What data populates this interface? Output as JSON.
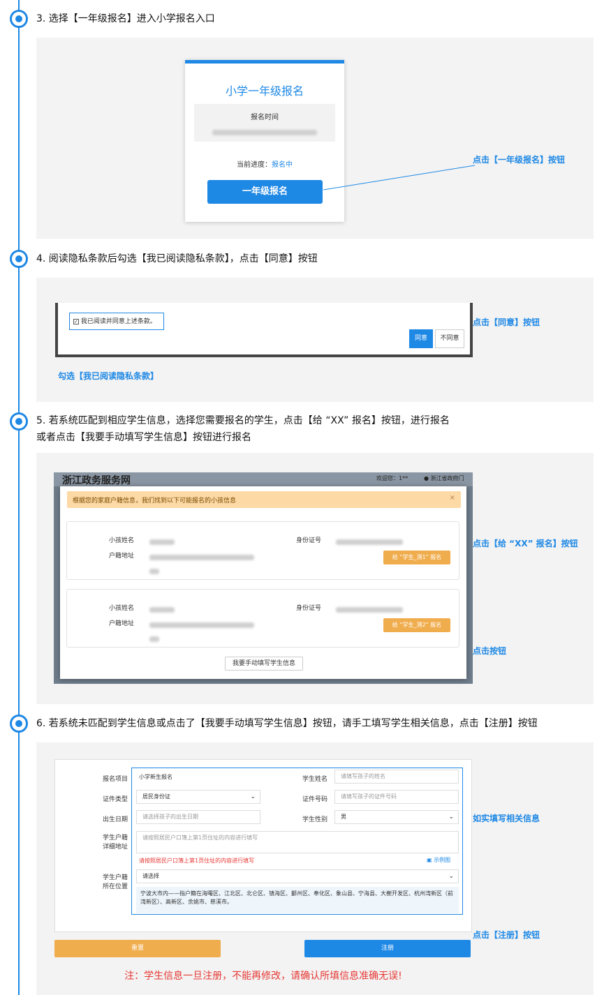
{
  "steps": [
    {
      "text": "3. 选择【一年级报名】进入小学报名入口"
    },
    {
      "text": "4. 阅读隐私条款后勾选【我已阅读隐私条款】，点击【同意】按钮"
    },
    {
      "text_line1": "5. 若系统匹配到相应学生信息，选择您需要报名的学生，点击【给 “XX” 报名】按钮，进行报名",
      "text_line2": "或者点击【我要手动填写学生信息】按钮进行报名"
    },
    {
      "text": "6. 若系统未匹配到学生信息或点击了【我要手动填写学生信息】按钮，请手工填写学生相关信息，点击【注册】按钮"
    }
  ],
  "step3": {
    "card_title": "小学一年级报名",
    "time_label": "报名时间",
    "progress_label": "当前进度：",
    "progress_value": "报名中",
    "button_label": "一年级报名",
    "annotation": "点击【一年级报名】按钮"
  },
  "step4": {
    "checkbox_label": "我已阅读并同意上述条款。",
    "agree_label": "同意",
    "disagree_label": "不同意",
    "annotation_agree": "点击【同意】按钮",
    "annotation_check": "勾选【我已阅读隐私条款】"
  },
  "step5": {
    "site_title": "浙江政务服务网",
    "welcome": "欢迎您：1**",
    "gov_link": "浙江省政府门",
    "alert": "根据您的家庭户籍信息，我们找到以下可能报名的小孩信息",
    "alert_close": "×",
    "child_name_label": "小孩姓名",
    "household_label": "户籍地址",
    "id_label": "身份证号",
    "children": [
      {
        "button": "给 “学生_测1” 报名"
      },
      {
        "button": "给 “学生_测2” 报名"
      }
    ],
    "manual_button": "我要手动填写学生信息",
    "annotation_enroll": "点击【给 “XX” 报名】按钮",
    "annotation_manual": "点击按钮"
  },
  "step6": {
    "project_label": "报名项目",
    "project_value": "小学新生报名",
    "student_name_label": "学生姓名",
    "student_name_placeholder": "请填写孩子的姓名",
    "id_type_label": "证件类型",
    "id_type_value": "居民身份证",
    "id_number_label": "证件号码",
    "id_number_placeholder": "请填写孩子的证件号码",
    "birth_label": "出生日期",
    "birth_placeholder": "请选择孩子的出生日期",
    "gender_label": "学生性别",
    "gender_value": "男",
    "address_label_1": "学生户籍",
    "address_label_2": "详细地址",
    "address_placeholder": "请按照居民户口簿上第1页住址的内容进行填写",
    "address_hint": "请按照居民户口簿上第1页住址的内容进行填写",
    "example_link": "示例图",
    "location_label_1": "学生户籍",
    "location_label_2": "所在位置",
    "location_value": "请选择",
    "note_text": "宁波大市内——指户籍在海曙区、江北区、北仑区、镇海区、鄞州区、奉化区、象山县、宁海县、大榭开发区、杭州湾新区（前湾新区）、高新区、余姚市、慈溪市。",
    "reset_label": "重置",
    "register_label": "注册",
    "warning": "注：学生信息一旦注册，不能再修改，请确认所填信息准确无误!",
    "annotation_fill": "如实填写相关信息",
    "annotation_register": "点击【注册】按钮"
  },
  "colors": {
    "accent": "#1e88e5",
    "orange": "#f0ad4e",
    "warning": "#e53935"
  }
}
